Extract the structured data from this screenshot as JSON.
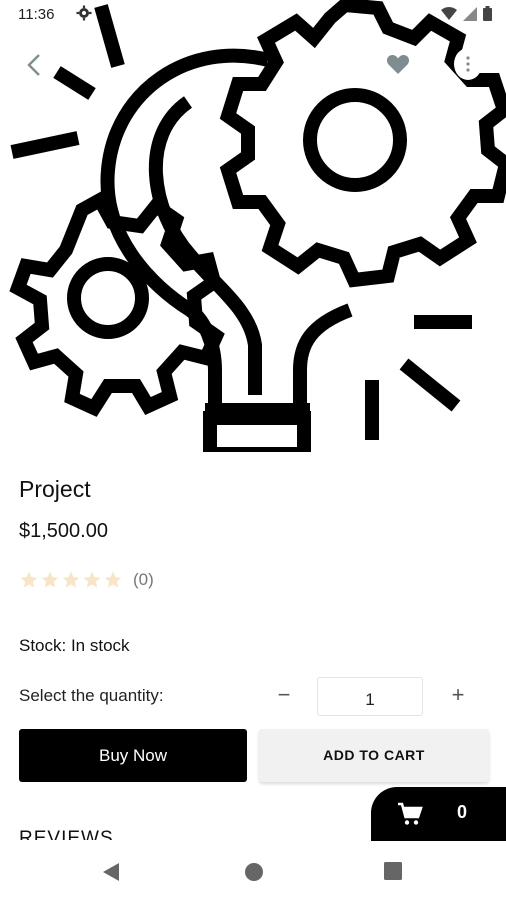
{
  "status_bar": {
    "time": "11:36",
    "icons": [
      "settings-icon",
      "wifi-icon",
      "signal-icon",
      "battery-icon"
    ]
  },
  "hero_image": {
    "description_icon": "lightbulb-gears-icon"
  },
  "top_actions": {
    "back_icon": "chevron-left-icon",
    "favorite_icon": "heart-icon",
    "more_icon": "more-vert-icon"
  },
  "product": {
    "title": "Project",
    "price": "$1,500.00",
    "rating_value": 0,
    "rating_max": 5,
    "rating_count": "(0)",
    "stock": "Stock: In stock"
  },
  "quantity": {
    "label": "Select the quantity:",
    "minus": "−",
    "value": "1",
    "plus": "+"
  },
  "buttons": {
    "buy_now": "Buy Now",
    "add_to_cart": "ADD TO CART"
  },
  "reviews": {
    "heading": "REVIEWS"
  },
  "cart": {
    "count": "0"
  },
  "colors": {
    "primary": "#000000",
    "secondary_button": "#f1f1f1",
    "star_empty": "#f8e4c6",
    "icon_muted": "#7f8d91"
  }
}
